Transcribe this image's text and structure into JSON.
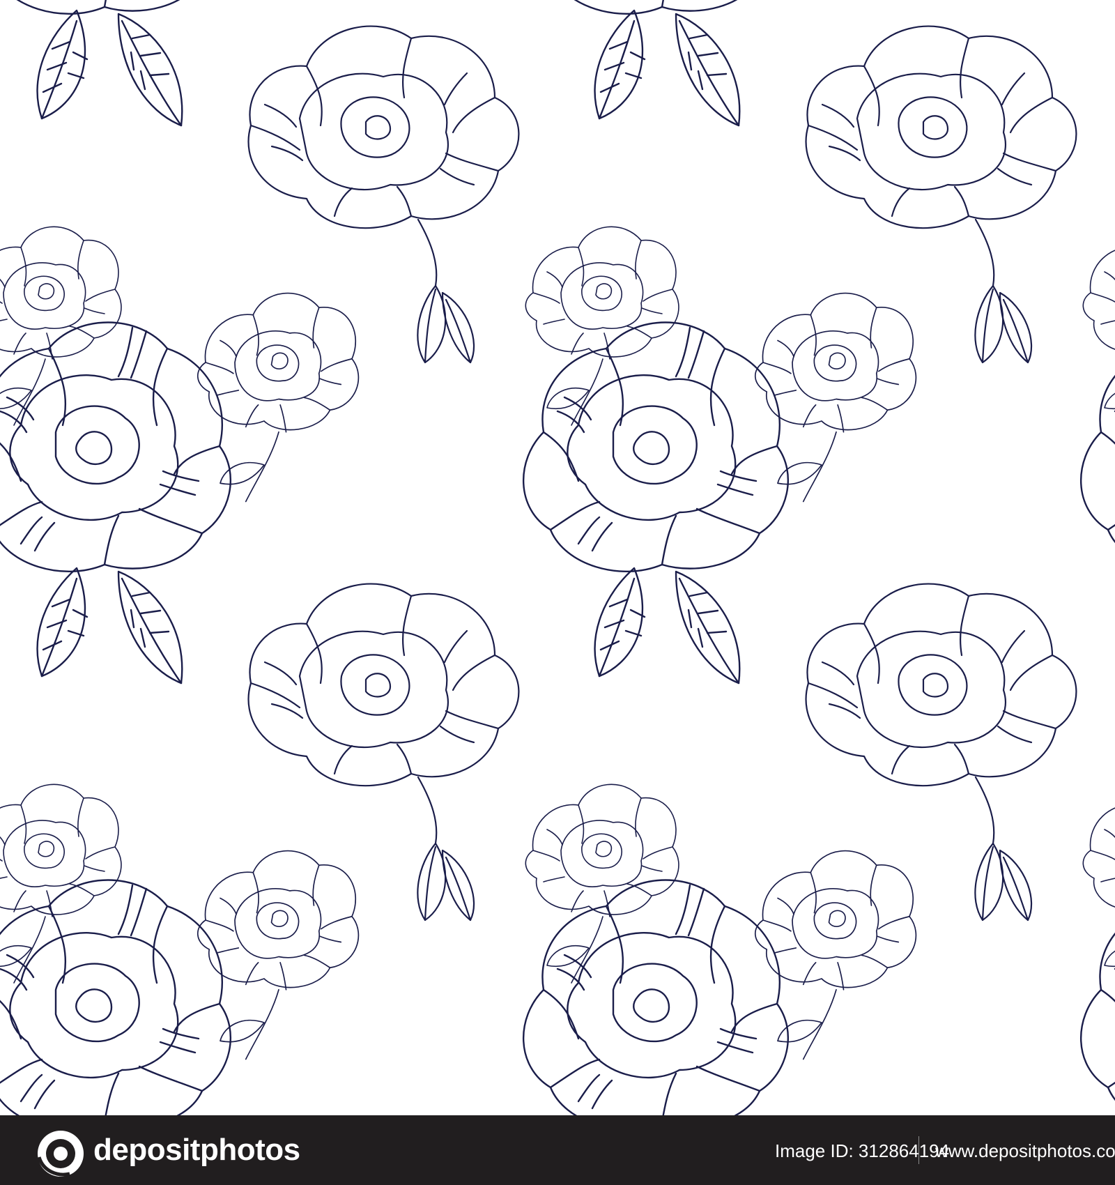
{
  "image": {
    "description_colors": {
      "line": "#1a1d4a",
      "background": "#ffffff",
      "footer_bg": "#211e1f",
      "footer_text": "#ffffff"
    },
    "motif_icon": "rose-outline-illustration"
  },
  "footer": {
    "logo_icon": "depositphotos-logo-icon",
    "brand": "depositphotos",
    "image_id": "Image ID: 312864194",
    "site_url": "www.depositphotos.com"
  }
}
